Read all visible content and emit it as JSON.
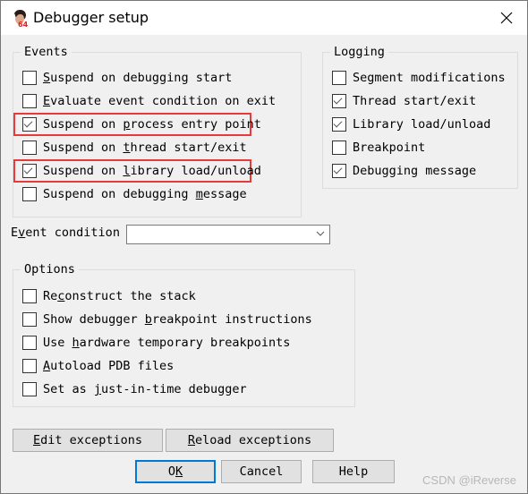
{
  "window": {
    "title": "Debugger setup",
    "icon": "ida64-icon",
    "close_icon": "close-icon"
  },
  "events": {
    "label": "Events",
    "items": [
      {
        "pre": "",
        "ul": "S",
        "post": "uspend on debugging start",
        "checked": false,
        "highlighted": false
      },
      {
        "pre": "",
        "ul": "E",
        "post": "valuate event condition on exit",
        "checked": false,
        "highlighted": false
      },
      {
        "pre": "Suspend on ",
        "ul": "p",
        "post": "rocess entry point",
        "checked": true,
        "highlighted": true
      },
      {
        "pre": "Suspend on ",
        "ul": "t",
        "post": "hread start/exit",
        "checked": false,
        "highlighted": false
      },
      {
        "pre": "Suspend on ",
        "ul": "l",
        "post": "ibrary load/unload",
        "checked": true,
        "highlighted": true
      },
      {
        "pre": "Suspend on debugging ",
        "ul": "m",
        "post": "essage",
        "checked": false,
        "highlighted": false
      }
    ]
  },
  "logging": {
    "label": "Logging",
    "items": [
      {
        "label": "Segment modifications",
        "checked": false
      },
      {
        "label": "Thread start/exit",
        "checked": true
      },
      {
        "label": "Library load/unload",
        "checked": true
      },
      {
        "label": "Breakpoint",
        "checked": false
      },
      {
        "label": "Debugging message",
        "checked": true
      }
    ]
  },
  "event_condition": {
    "label_pre": "E",
    "label_ul": "v",
    "label_post": "ent condition",
    "value": ""
  },
  "options": {
    "label": "Options",
    "items": [
      {
        "pre": "Re",
        "ul": "c",
        "post": "onstruct the stack",
        "checked": false
      },
      {
        "pre": "Show debugger ",
        "ul": "b",
        "post": "reakpoint instructions",
        "checked": false
      },
      {
        "pre": "Use ",
        "ul": "h",
        "post": "ardware temporary breakpoints",
        "checked": false
      },
      {
        "pre": "",
        "ul": "A",
        "post": "utoload PDB files",
        "checked": false
      },
      {
        "pre": "Set as ",
        "ul": "j",
        "post": "ust-in-time debugger",
        "checked": false
      }
    ]
  },
  "buttons": {
    "edit_exceptions": {
      "ul": "E",
      "post": "dit exceptions"
    },
    "reload_exceptions": {
      "ul": "R",
      "post": "eload exceptions"
    },
    "ok": {
      "pre": "O",
      "ul": "K"
    },
    "cancel": "Cancel",
    "help": "Help"
  },
  "colors": {
    "highlight": "#e83a3a",
    "default_button_border": "#0078d7"
  },
  "watermark": "CSDN @iReverse"
}
